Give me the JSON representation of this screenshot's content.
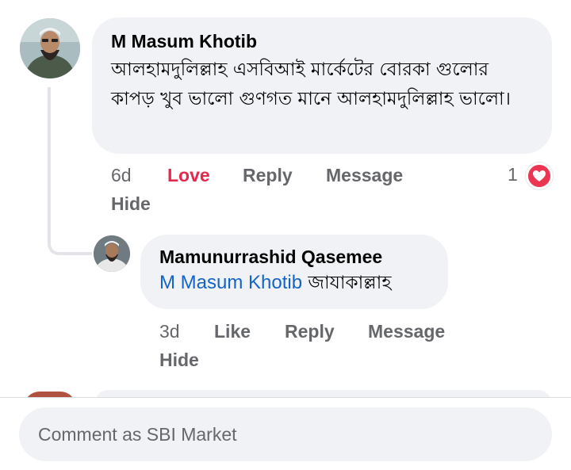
{
  "comment": {
    "author": "M Masum Khotib",
    "text": "আলহামদুলিল্লাহ এসবিআই মার্কেটের বোরকা গুলোর কাপড় খুব ভালো গুণগত মানে আলহামদুলিল্লাহ ভালো।",
    "time": "6d",
    "reaction_label": "Love",
    "reply_label": "Reply",
    "message_label": "Message",
    "hide_label": "Hide",
    "reaction_count": "1",
    "reaction_icon": "heart-icon",
    "reaction_color": "#e4294a"
  },
  "reply": {
    "author": "Mamunurrashid Qasemee",
    "mention": "M Masum Khotib",
    "text": "জাযাকাল্লাহ",
    "time": "3d",
    "like_label": "Like",
    "reply_label": "Reply",
    "message_label": "Message",
    "hide_label": "Hide"
  },
  "composer": {
    "placeholder": "Comment as SBI Market"
  },
  "colors": {
    "link": "#1464c8",
    "muted": "#65676b",
    "bubble": "#f0f2f5"
  }
}
